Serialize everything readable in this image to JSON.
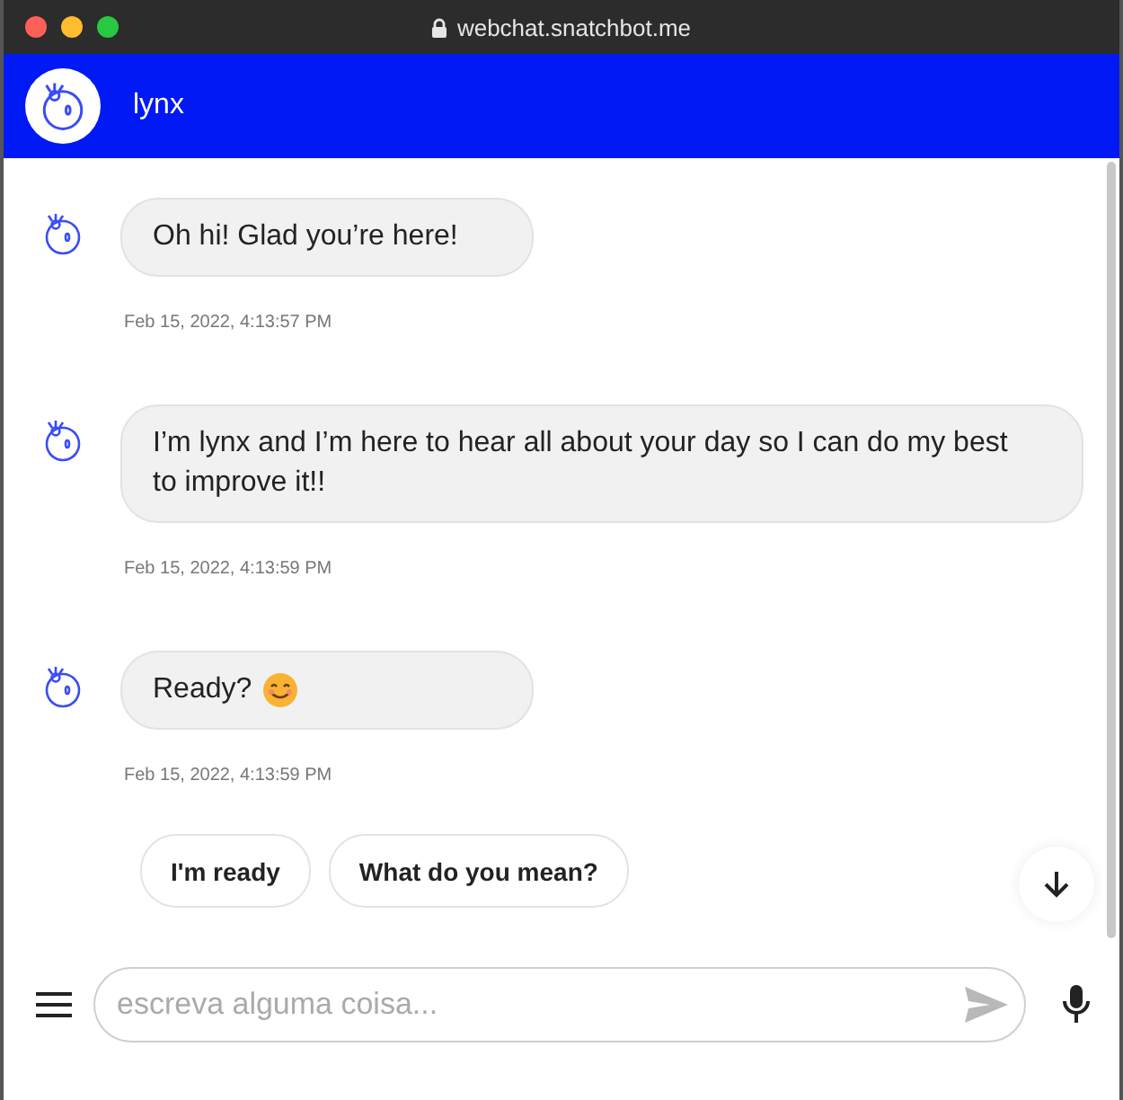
{
  "window": {
    "url": "webchat.snatchbot.me"
  },
  "header": {
    "bot_name": "lynx"
  },
  "messages": [
    {
      "text": "Oh hi! Glad you’re here!",
      "time": "Feb 15, 2022, 4:13:57 PM"
    },
    {
      "text": "I’m lynx and I’m here to hear all about your day so I can do my best to improve it!!",
      "time": "Feb 15, 2022, 4:13:59 PM"
    },
    {
      "text": "Ready?",
      "time": "Feb 15, 2022, 4:13:59 PM",
      "emoji": true
    }
  ],
  "quick_replies": [
    "I'm ready",
    "What do you mean?"
  ],
  "composer": {
    "placeholder": "escreva alguma coisa..."
  }
}
